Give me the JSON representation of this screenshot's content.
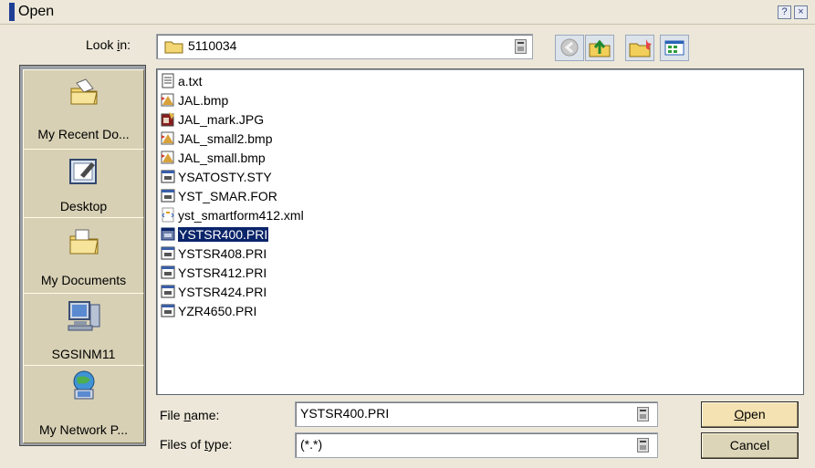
{
  "window": {
    "title": "Open",
    "help_glyph": "?",
    "close_glyph": "×"
  },
  "lookin": {
    "label_pre": "Look ",
    "label_mn": "i",
    "label_post": "n:",
    "value": "5110034"
  },
  "toolbar": {
    "icons": [
      "back-icon",
      "up-folder-icon",
      "new-folder-icon",
      "view-menu-icon"
    ]
  },
  "places": [
    {
      "label": "My Recent Do...",
      "icon": "recent-documents-icon"
    },
    {
      "label": "Desktop",
      "icon": "desktop-icon"
    },
    {
      "label": "My Documents",
      "icon": "my-documents-icon"
    },
    {
      "label": "SGSINM11",
      "icon": "computer-icon"
    },
    {
      "label": "My Network P...",
      "icon": "network-places-icon"
    }
  ],
  "files": [
    {
      "name": "a.txt",
      "type": "text"
    },
    {
      "name": "JAL.bmp",
      "type": "bitmap"
    },
    {
      "name": "JAL_mark.JPG",
      "type": "jpeg"
    },
    {
      "name": "JAL_small2.bmp",
      "type": "bitmap"
    },
    {
      "name": "JAL_small.bmp",
      "type": "bitmap"
    },
    {
      "name": "YSATOSTY.STY",
      "type": "generic"
    },
    {
      "name": "YST_SMAR.FOR",
      "type": "generic"
    },
    {
      "name": "yst_smartform412.xml",
      "type": "xml"
    },
    {
      "name": "YSTSR400.PRI",
      "type": "generic",
      "selected": true
    },
    {
      "name": "YSTSR408.PRI",
      "type": "generic"
    },
    {
      "name": "YSTSR412.PRI",
      "type": "generic"
    },
    {
      "name": "YSTSR424.PRI",
      "type": "generic"
    },
    {
      "name": "YZR4650.PRI",
      "type": "generic"
    }
  ],
  "filename": {
    "label_pre": "File ",
    "label_mn": "n",
    "label_post": "ame:",
    "value": "YSTSR400.PRI"
  },
  "filetype": {
    "label_pre": "Files of ",
    "label_mn": "t",
    "label_post": "ype:",
    "value": "(*.*)"
  },
  "buttons": {
    "open_mn": "O",
    "open_rest": "pen",
    "cancel": "Cancel"
  },
  "colors": {
    "dialog_bg": "#ece7d8",
    "selection": "#0a246a",
    "places_bg": "#9c9fa6"
  }
}
